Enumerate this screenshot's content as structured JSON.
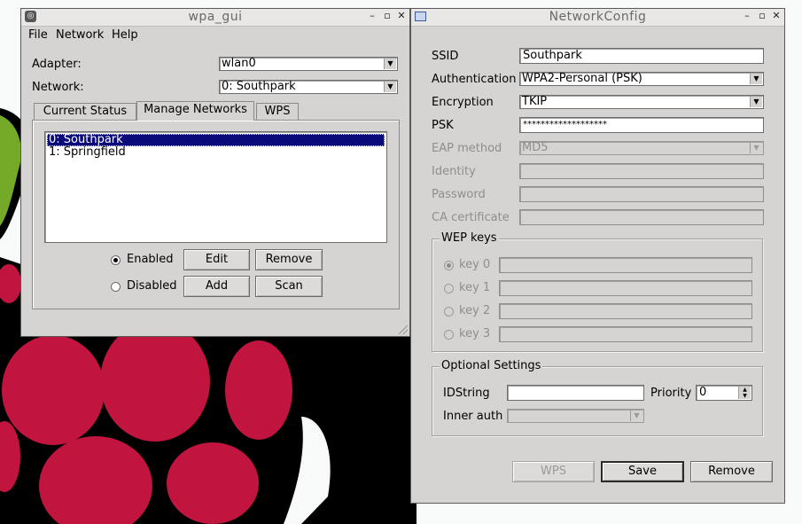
{
  "colors": {
    "raspberry_red": "#c1143f",
    "leaf_green": "#75a928",
    "selection": "#0a0a7a"
  },
  "wpa_gui": {
    "title": "wpa_gui",
    "menus": [
      "File",
      "Network",
      "Help"
    ],
    "adapter_label": "Adapter:",
    "adapter_value": "wlan0",
    "network_label": "Network:",
    "network_value": "0: Southpark",
    "tabs": [
      "Current Status",
      "Manage Networks",
      "WPS"
    ],
    "networks": [
      "0: Southpark",
      "1: Springfield"
    ],
    "enabled_label": "Enabled",
    "disabled_label": "Disabled",
    "edit_label": "Edit",
    "remove_label": "Remove",
    "add_label": "Add",
    "scan_label": "Scan"
  },
  "netconfig": {
    "title": "NetworkConfig",
    "ssid_label": "SSID",
    "ssid_value": "Southpark",
    "auth_label": "Authentication",
    "auth_value": "WPA2-Personal (PSK)",
    "enc_label": "Encryption",
    "enc_value": "TKIP",
    "psk_label": "PSK",
    "psk_value": "*******************",
    "eap_label": "EAP method",
    "eap_value": "MD5",
    "identity_label": "Identity",
    "password_label": "Password",
    "ca_label": "CA certificate",
    "wep_title": "WEP keys",
    "wep_keys": [
      "key 0",
      "key 1",
      "key 2",
      "key 3"
    ],
    "optional_title": "Optional Settings",
    "idstring_label": "IDString",
    "priority_label": "Priority",
    "priority_value": "0",
    "inner_auth_label": "Inner auth",
    "wps_label": "WPS",
    "save_label": "Save",
    "remove_label": "Remove"
  }
}
